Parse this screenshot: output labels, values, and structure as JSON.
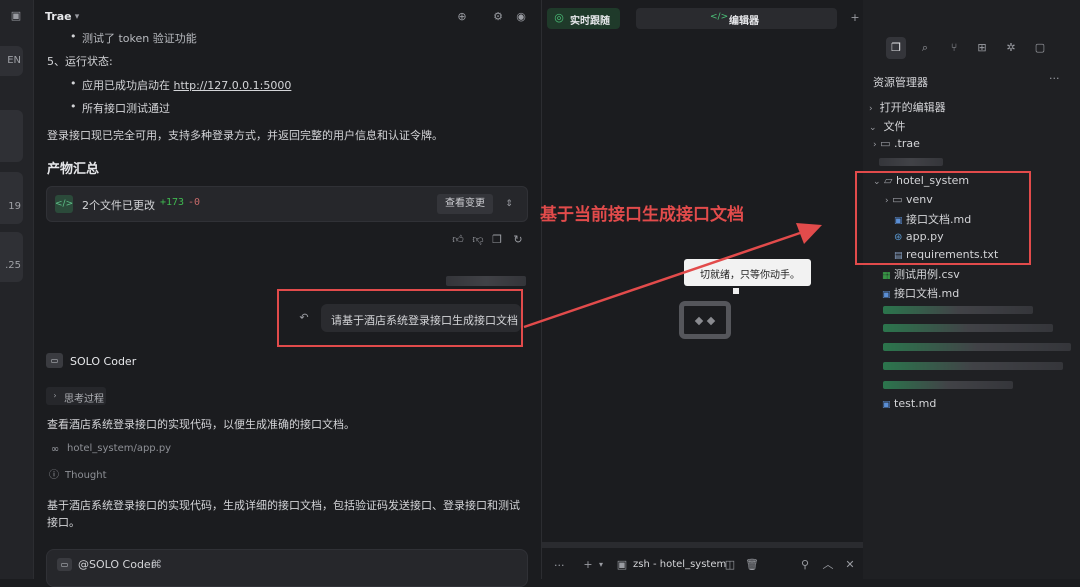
{
  "left_strip": {
    "cards": [
      "EN",
      "",
      "19",
      ".25"
    ]
  },
  "chat": {
    "header_title": "Trae",
    "bullet_top": "测试了 token 验证功能",
    "section5_title": "5、运行状态:",
    "bullet_started": "应用已成功启动在",
    "bullet_started_link": "http://127.0.0.1:5000",
    "bullet_tests": "所有接口测试通过",
    "summary_text": "登录接口现已完全可用，支持多种登录方式，并返回完整的用户信息和认证令牌。",
    "artifacts_title": "产物汇总",
    "changes_label": "2个文件已更改",
    "changes_add": "+173",
    "changes_del": "-0",
    "view_changes_button": "查看变更",
    "user_message": "请基于酒店系统登录接口生成接口文档",
    "agent_name": "SOLO Coder",
    "thinking_label": "思考过程",
    "agent_text1": "查看酒店系统登录接口的实现代码，以便生成准确的接口文档。",
    "file_ref": "hotel_system/app.py",
    "thought_label": "Thought",
    "agent_text2_line1": "基于酒店系统登录接口的实现代码，生成详细的接口文档，包括验证码发送接口、登录接口和测试",
    "agent_text2_line2": "接口。",
    "input_mention": "@SOLO Coder",
    "input_mention_icon": "⌘"
  },
  "middle": {
    "tab_live": "实时跟随",
    "tab_editor": "编辑器",
    "tab_editor_icon": "</>",
    "status_bubble": "切就绪，只等你动手。",
    "terminal_label": "zsh - hotel_system",
    "terminal_dots": "···"
  },
  "explorer": {
    "title": "资源管理器",
    "more": "···",
    "open_editors": "打开的编辑器",
    "files_section": "文件",
    "items": {
      "trae": ".trae",
      "hotel_system": "hotel_system",
      "venv": "venv",
      "api_doc_md": "接口文档.md",
      "app_py": "app.py",
      "requirements": "requirements.txt",
      "test_cases_csv": "测试用例.csv",
      "api_doc_root": "接口文档.md",
      "test_md": "test.md"
    }
  },
  "annotation": {
    "text": "基于当前接口生成接口文档",
    "color": "#e24b4b"
  },
  "colors": {
    "accent_green": "#2ea043",
    "diff_add": "#3fb950",
    "diff_del": "#f85149",
    "annotation_red": "#e24b4b"
  }
}
